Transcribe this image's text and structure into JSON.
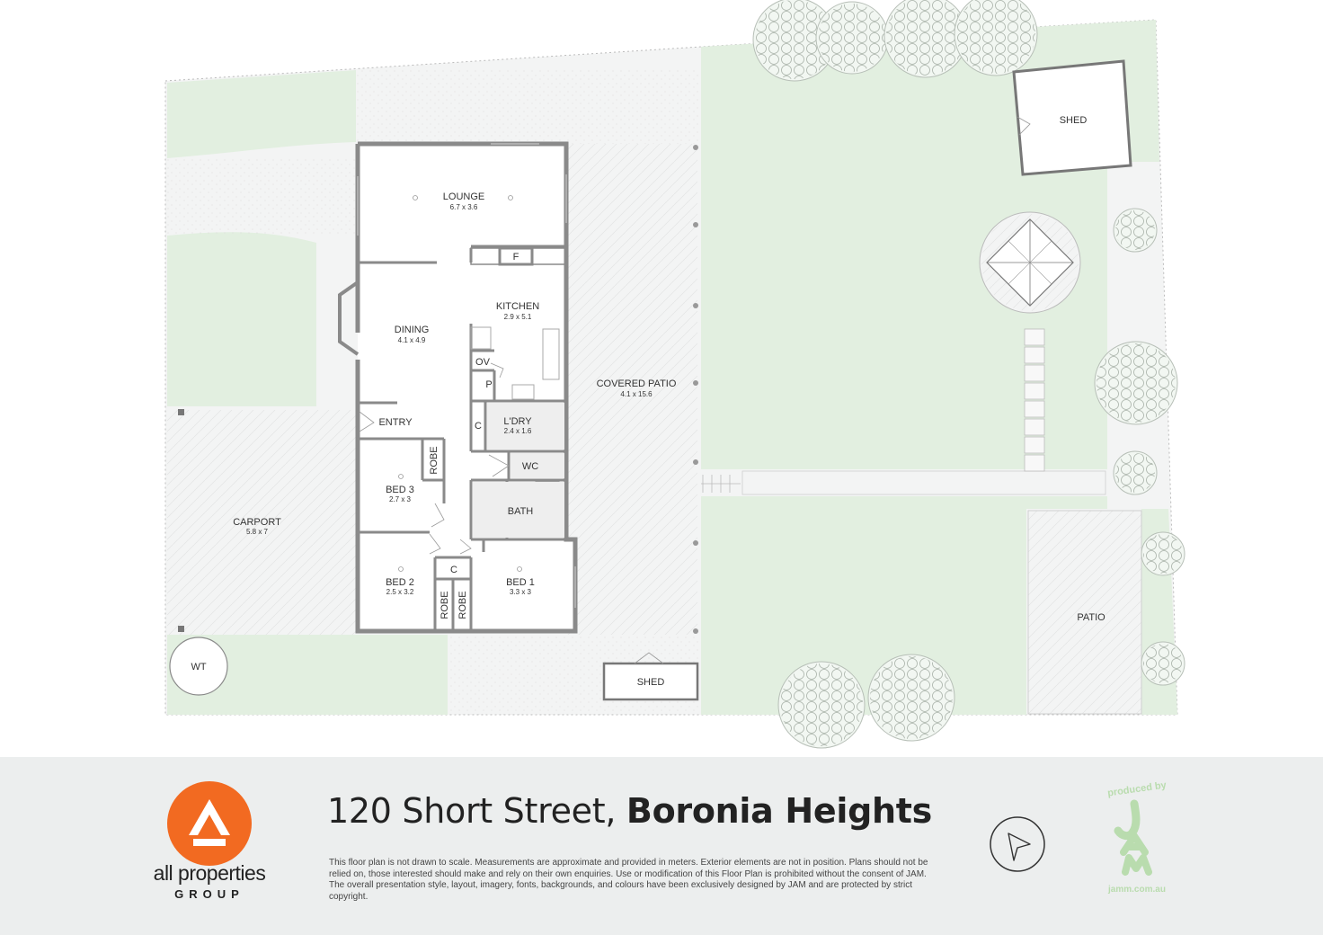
{
  "rooms": {
    "lounge": {
      "name": "LOUNGE",
      "size": "6.7 x 3.6"
    },
    "kitchen": {
      "name": "KITCHEN",
      "size": "2.9 x 5.1"
    },
    "dining": {
      "name": "DINING",
      "size": "4.1 x 4.9"
    },
    "covered_patio": {
      "name": "COVERED PATIO",
      "size": "4.1 x 15.6"
    },
    "entry": {
      "name": "ENTRY"
    },
    "laundry": {
      "name": "L'DRY",
      "size": "2.4 x 1.6"
    },
    "wc": {
      "name": "WC"
    },
    "bed3": {
      "name": "BED 3",
      "size": "2.7 x 3"
    },
    "bath": {
      "name": "BATH"
    },
    "carport": {
      "name": "CARPORT",
      "size": "5.8 x 7"
    },
    "bed2": {
      "name": "BED 2",
      "size": "2.5 x 3.2"
    },
    "bed1": {
      "name": "BED 1",
      "size": "3.3 x 3"
    },
    "patio": {
      "name": "PATIO"
    },
    "shed_main": {
      "name": "SHED"
    },
    "shed_small": {
      "name": "SHED"
    },
    "water_tank": {
      "name": "WT"
    }
  },
  "fixtures": {
    "fridge": "F",
    "oven": "OV",
    "pantry": "P",
    "cupboard_laundry": "C",
    "cupboard_hall": "C",
    "robe_bed3": "ROBE",
    "robe_bed2": "ROBE",
    "robe_bed1": "ROBE"
  },
  "footer": {
    "address_street": "120 Short Street,",
    "address_suburb": "Boronia Heights",
    "brand_name": "all properties",
    "brand_group": "GROUP",
    "disclaimer": "This floor plan is not drawn to scale. Measurements are approximate and provided in meters. Exterior elements are not in position. Plans should not be relied on, those interested should make and rely on their own enquiries. Use or modification of this Floor Plan is prohibited without the consent of JAM. The overall presentation style, layout, imagery, fonts, backgrounds, and colours have been exclusively designed by JAM and are protected by strict copyright.",
    "jam_produced": "produced by",
    "jam_site": "jamm.com.au"
  },
  "colors": {
    "lawn": "#e2efe0",
    "paving": "#f3f4f4",
    "wall": "#8a8a8a",
    "brand_orange": "#f26a21",
    "footer_bg": "#eceeee",
    "jam_green": "#b9dcae"
  },
  "icons": [
    "north-arrow-icon",
    "all-properties-logo-icon",
    "jam-logo-icon"
  ]
}
